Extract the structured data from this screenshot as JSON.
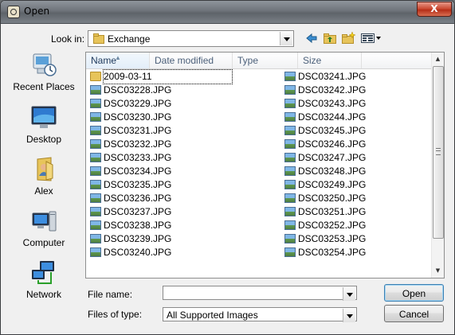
{
  "window": {
    "title": "Open",
    "close_symbol": "X"
  },
  "toolbar": {
    "look_in_label": "Look in:",
    "look_in_value": "Exchange",
    "icons": [
      "back-icon",
      "up-folder-icon",
      "new-folder-icon",
      "view-menu-icon"
    ]
  },
  "places": [
    {
      "label": "Recent Places",
      "icon": "recent-places-icon"
    },
    {
      "label": "Desktop",
      "icon": "desktop-icon"
    },
    {
      "label": "Alex",
      "icon": "user-folder-icon"
    },
    {
      "label": "Computer",
      "icon": "computer-icon"
    },
    {
      "label": "Network",
      "icon": "network-icon"
    }
  ],
  "columns": [
    {
      "label": "Name",
      "sorted": true
    },
    {
      "label": "Date modified"
    },
    {
      "label": "Type"
    },
    {
      "label": "Size"
    }
  ],
  "files_col1": [
    {
      "name": "2009-03-11",
      "type": "folder",
      "focused": true
    },
    {
      "name": "DSC03228.JPG",
      "type": "jpg"
    },
    {
      "name": "DSC03229.JPG",
      "type": "jpg"
    },
    {
      "name": "DSC03230.JPG",
      "type": "jpg"
    },
    {
      "name": "DSC03231.JPG",
      "type": "jpg"
    },
    {
      "name": "DSC03232.JPG",
      "type": "jpg"
    },
    {
      "name": "DSC03233.JPG",
      "type": "jpg"
    },
    {
      "name": "DSC03234.JPG",
      "type": "jpg"
    },
    {
      "name": "DSC03235.JPG",
      "type": "jpg"
    },
    {
      "name": "DSC03236.JPG",
      "type": "jpg"
    },
    {
      "name": "DSC03237.JPG",
      "type": "jpg"
    },
    {
      "name": "DSC03238.JPG",
      "type": "jpg"
    },
    {
      "name": "DSC03239.JPG",
      "type": "jpg"
    },
    {
      "name": "DSC03240.JPG",
      "type": "jpg"
    }
  ],
  "files_col2": [
    {
      "name": "DSC03241.JPG",
      "type": "jpg"
    },
    {
      "name": "DSC03242.JPG",
      "type": "jpg"
    },
    {
      "name": "DSC03243.JPG",
      "type": "jpg"
    },
    {
      "name": "DSC03244.JPG",
      "type": "jpg"
    },
    {
      "name": "DSC03245.JPG",
      "type": "jpg"
    },
    {
      "name": "DSC03246.JPG",
      "type": "jpg"
    },
    {
      "name": "DSC03247.JPG",
      "type": "jpg"
    },
    {
      "name": "DSC03248.JPG",
      "type": "jpg"
    },
    {
      "name": "DSC03249.JPG",
      "type": "jpg"
    },
    {
      "name": "DSC03250.JPG",
      "type": "jpg"
    },
    {
      "name": "DSC03251.JPG",
      "type": "jpg"
    },
    {
      "name": "DSC03252.JPG",
      "type": "jpg"
    },
    {
      "name": "DSC03253.JPG",
      "type": "jpg"
    },
    {
      "name": "DSC03254.JPG",
      "type": "jpg"
    }
  ],
  "footer": {
    "file_name_label": "File name:",
    "file_name_value": "",
    "files_of_type_label": "Files of type:",
    "files_of_type_value": "All Supported Images",
    "open_label": "Open",
    "cancel_label": "Cancel"
  },
  "colors": {
    "title_bar": "#6e737a",
    "close_button": "#c8432c",
    "header_text": "#4c607a"
  }
}
